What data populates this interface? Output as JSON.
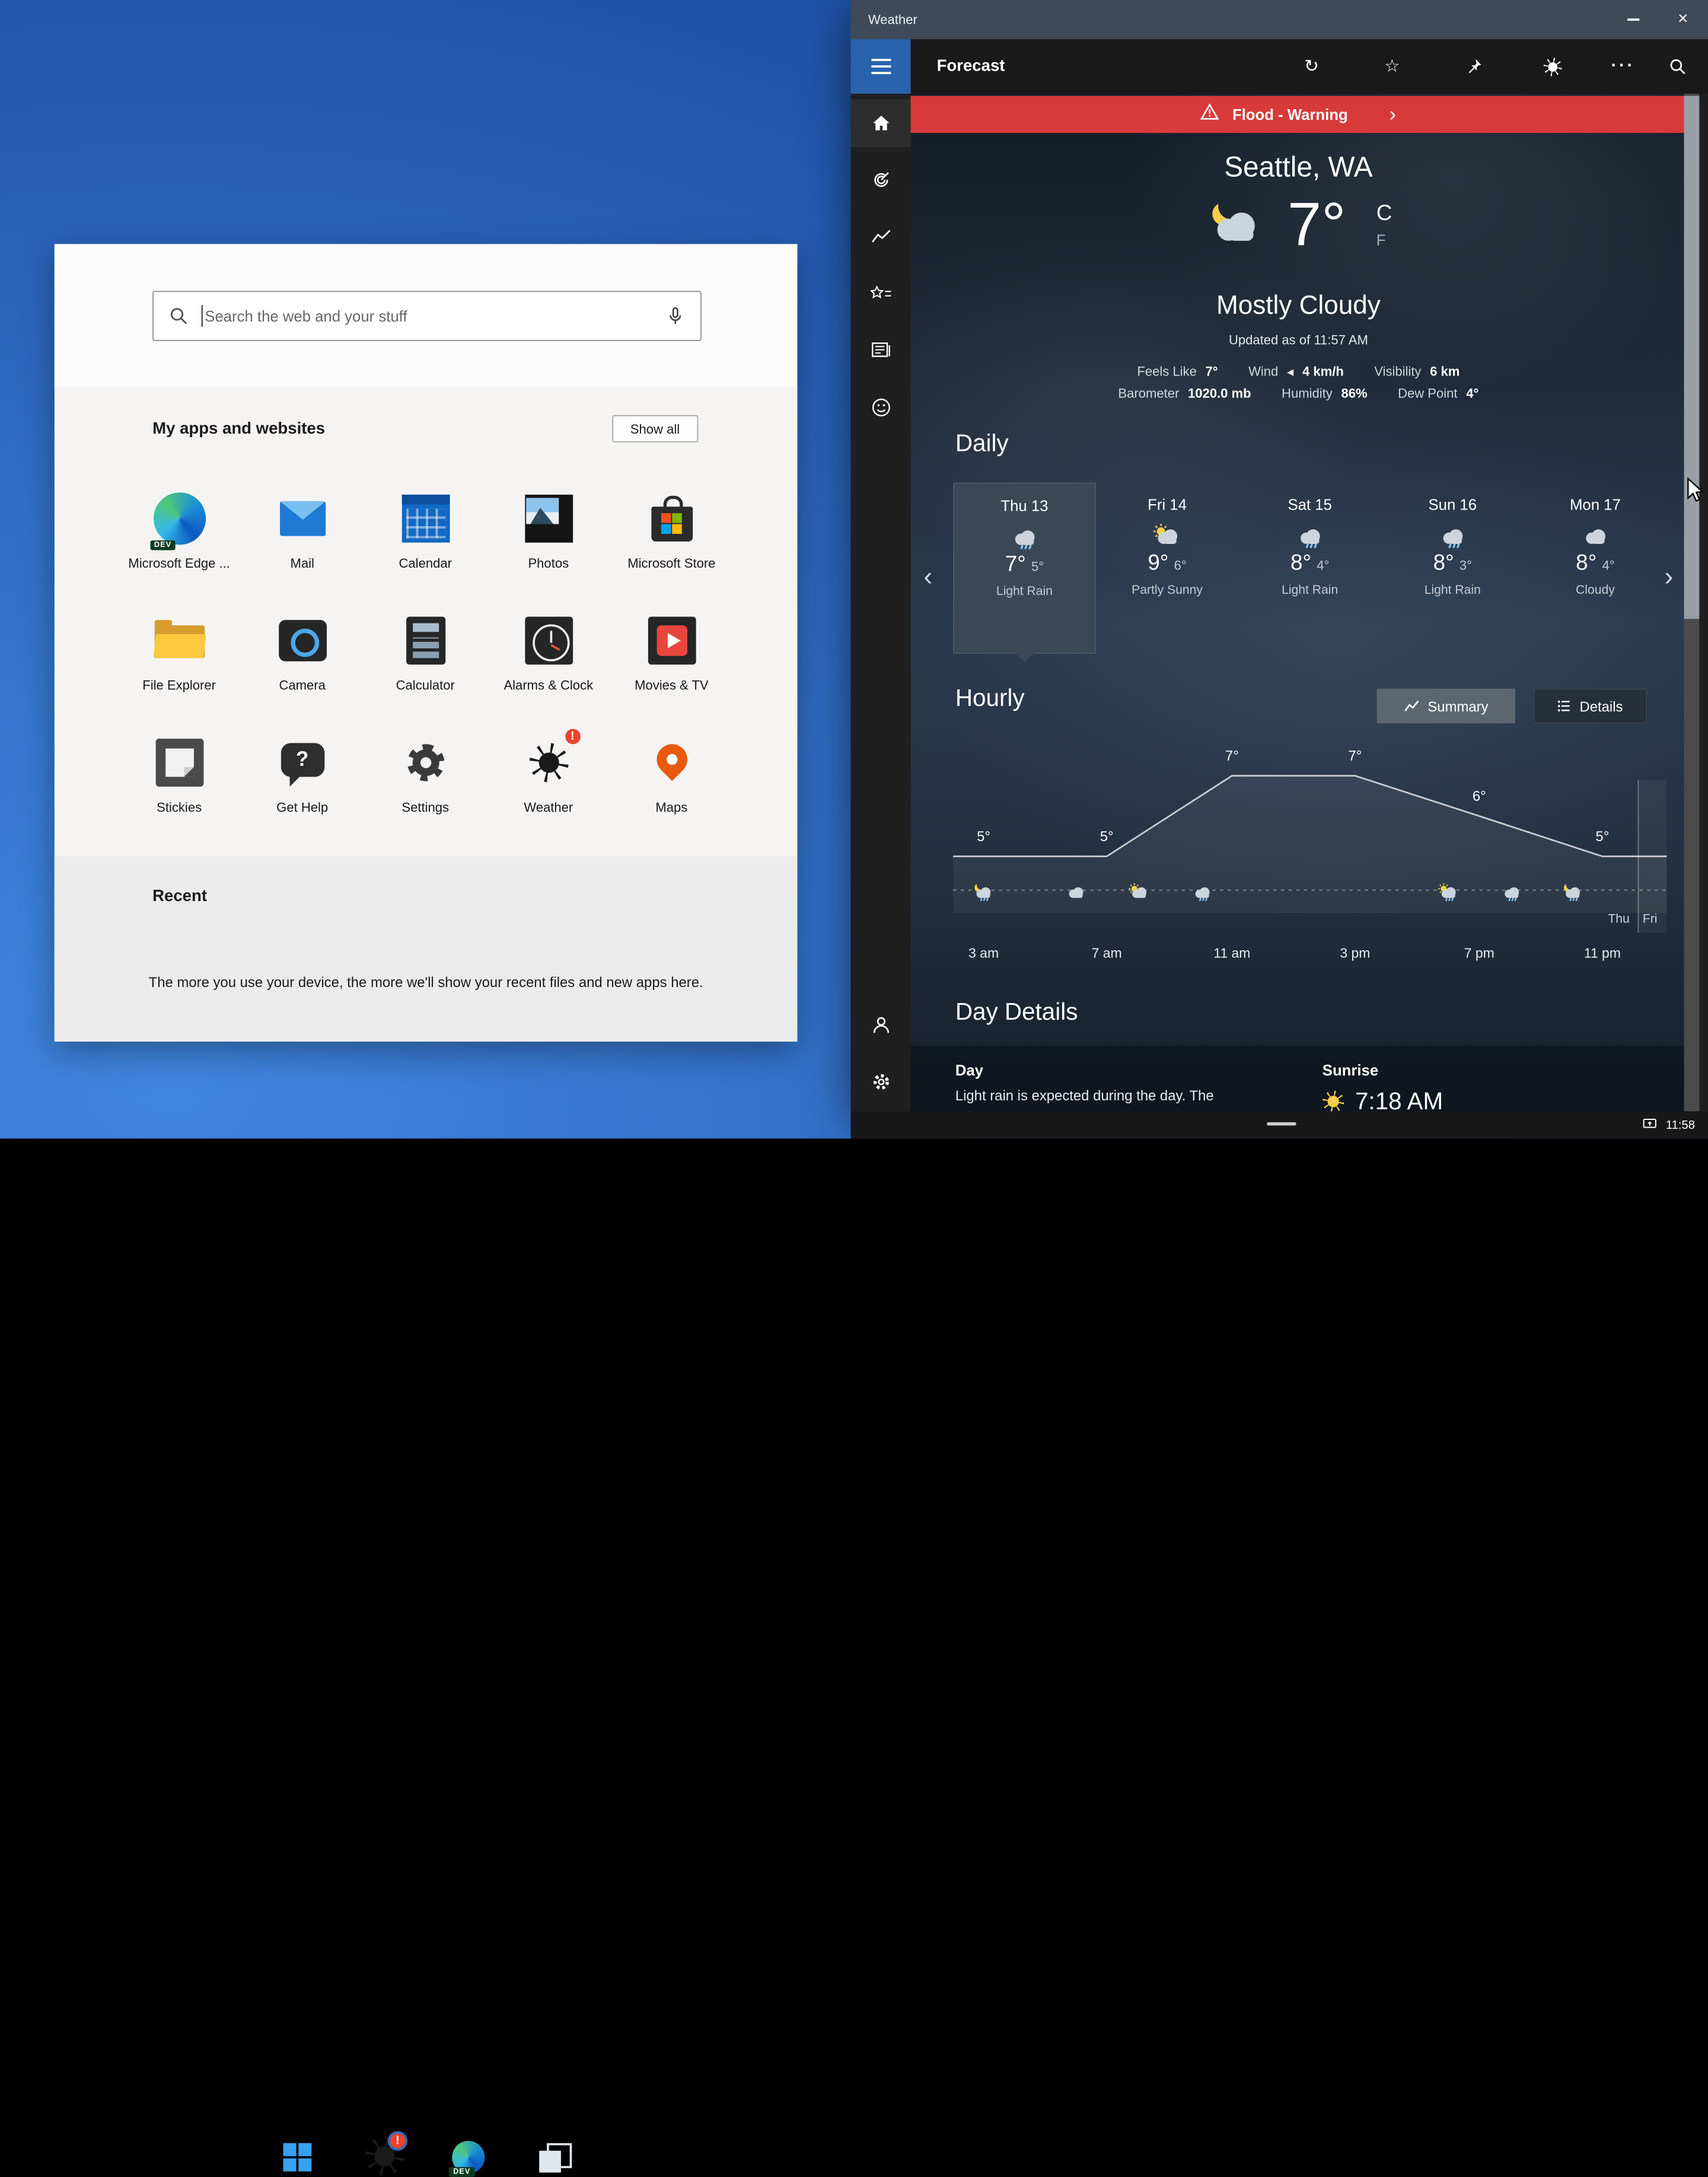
{
  "colors": {
    "accent": "#2a63ad",
    "alert": "#d83a3a",
    "titlebar": "#3e4a57"
  },
  "icon_glyphs": {
    "dev_badge": "DEV",
    "help_question": "?"
  },
  "desktop": {
    "taskbar": {
      "time": "11:58",
      "badge": "!"
    }
  },
  "start_panel": {
    "search": {
      "placeholder": "Search the web and your stuff"
    },
    "apps_section": {
      "title": "My apps and websites",
      "show_all": "Show all"
    },
    "apps": [
      {
        "label": "Microsoft Edge ...",
        "icon": "edge"
      },
      {
        "label": "Mail",
        "icon": "mail"
      },
      {
        "label": "Calendar",
        "icon": "calendar"
      },
      {
        "label": "Photos",
        "icon": "photos"
      },
      {
        "label": "Microsoft Store",
        "icon": "store"
      },
      {
        "label": "File Explorer",
        "icon": "explorer"
      },
      {
        "label": "Camera",
        "icon": "camera"
      },
      {
        "label": "Calculator",
        "icon": "calculator"
      },
      {
        "label": "Alarms & Clock",
        "icon": "clock"
      },
      {
        "label": "Movies & TV",
        "icon": "movies"
      },
      {
        "label": "Stickies",
        "icon": "stickies"
      },
      {
        "label": "Get Help",
        "icon": "gethelp"
      },
      {
        "label": "Settings",
        "icon": "settings"
      },
      {
        "label": "Weather",
        "icon": "weather",
        "badge": "!"
      },
      {
        "label": "Maps",
        "icon": "maps"
      }
    ],
    "recent": {
      "title": "Recent",
      "empty_text": "The more you use your device, the more we'll show your recent files and new apps here."
    }
  },
  "weather": {
    "window_title": "Weather",
    "page_title": "Forecast",
    "alert": {
      "label": "Flood - Warning"
    },
    "current": {
      "location": "Seattle, WA",
      "temp": "7°",
      "unit_primary": "C",
      "unit_secondary": "F",
      "condition": "Mostly Cloudy",
      "updated": "Updated as of 11:57 AM",
      "details": [
        {
          "label": "Feels Like",
          "value": "7°"
        },
        {
          "label": "Wind",
          "value": "4 km/h",
          "arrow": true
        },
        {
          "label": "Visibility",
          "value": "6 km"
        },
        {
          "label": "Barometer",
          "value": "1020.0 mb"
        },
        {
          "label": "Humidity",
          "value": "86%"
        },
        {
          "label": "Dew Point",
          "value": "4°"
        }
      ]
    },
    "daily": {
      "title": "Daily",
      "days": [
        {
          "name": "Thu 13",
          "high": "7°",
          "low": "5°",
          "condition": "Light Rain",
          "icon": "rain",
          "selected": true
        },
        {
          "name": "Fri 14",
          "high": "9°",
          "low": "6°",
          "condition": "Partly Sunny",
          "icon": "partly-sunny",
          "selected": false
        },
        {
          "name": "Sat 15",
          "high": "8°",
          "low": "4°",
          "condition": "Light Rain",
          "icon": "rain",
          "selected": false
        },
        {
          "name": "Sun 16",
          "high": "8°",
          "low": "3°",
          "condition": "Light Rain",
          "icon": "rain",
          "selected": false
        },
        {
          "name": "Mon 17",
          "high": "8°",
          "low": "4°",
          "condition": "Cloudy",
          "icon": "cloudy",
          "selected": false
        }
      ]
    },
    "hourly": {
      "title": "Hourly",
      "summary_label": "Summary",
      "details_label": "Details",
      "chart_data": {
        "type": "line",
        "x": [
          "3 am",
          "7 am",
          "11 am",
          "3 pm",
          "7 pm",
          "11 pm"
        ],
        "values": [
          5,
          5,
          7,
          7,
          6,
          5
        ],
        "unit": "°",
        "day_markers": [
          "Thu",
          "Fri"
        ],
        "icons": [
          "moon-rain",
          "cloudy",
          "partly-sunny",
          "rain",
          "partly-rain",
          "rain",
          "moon-rain"
        ]
      }
    },
    "day_details": {
      "title": "Day Details",
      "day_label": "Day",
      "day_text": "Light rain is expected during the day. The",
      "sunrise_label": "Sunrise",
      "sunrise_time": "7:18 AM"
    }
  }
}
